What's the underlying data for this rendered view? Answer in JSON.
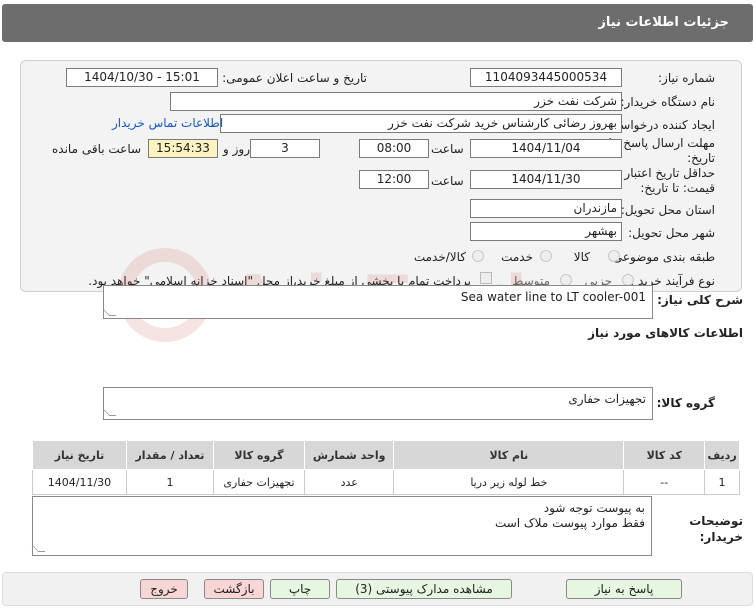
{
  "header": {
    "title": "جزئیات اطلاعات نیاز"
  },
  "form": {
    "need_number_label": "شماره نیاز:",
    "need_number": "1104093445000534",
    "announce_label": "تاریخ و ساعت اعلان عمومی:",
    "announce_value": "1404/10/30 - 15:01",
    "buyer_org_label": "نام دستگاه خریدار:",
    "buyer_org": "شرکت نفت خزر",
    "creator_label": "ایجاد کننده درخواست:",
    "creator": "بهروز رضائی کارشناس خرید شرکت نفت خزر",
    "contact_link": "اطلاعات تماس خریدار",
    "reply_deadline_label_1": "مهلت ارسال پاسخ: تا",
    "reply_deadline_label_2": "تاریخ:",
    "reply_date": "1404/11/04",
    "time_label": "ساعت",
    "reply_time": "08:00",
    "days_value": "3",
    "days_label": "روز و",
    "remaining_time": "15:54:33",
    "remaining_label": "ساعت باقی مانده",
    "price_validity_label_1": "حداقل تاریخ اعتبار",
    "price_validity_label_2": "قیمت: تا تاریخ:",
    "validity_date": "1404/11/30",
    "validity_time": "12:00",
    "province_label": "استان محل تحویل:",
    "province": "مازندران",
    "city_label": "شهر محل تحویل:",
    "city": "بهشهر",
    "category_label": "طبقه بندی موضوعی:",
    "category_options": [
      "کالا",
      "خدمت",
      "کالا/خدمت"
    ],
    "process_label": "نوع فرآیند خرید :",
    "process_options": [
      "جزیی",
      "متوسط"
    ],
    "payment_note": "پرداخت تمام یا بخشی از مبلغ خرید،از محل \"اسناد خزانه اسلامی\" خواهد بود."
  },
  "summary": {
    "label": "شرح کلی نیاز:",
    "value": "Sea water line to LT cooler-001"
  },
  "goods": {
    "section_title": "اطلاعات کالاهای مورد نیاز",
    "group_label": "گروه کالا:",
    "group_value": "تجهیزات حفاری"
  },
  "table": {
    "headers": [
      "ردیف",
      "کد کالا",
      "نام کالا",
      "واحد شمارش",
      "گروه کالا",
      "تعداد / مقدار",
      "تاریخ نیاز"
    ],
    "rows": [
      [
        "1",
        "--",
        "خط لوله زیر دریا",
        "عدد",
        "تجهیزات حفاری",
        "1",
        "1404/11/30"
      ]
    ]
  },
  "buyer_notes": {
    "label_1": "توضیحات",
    "label_2": "خریدار:",
    "text": "به پیوست توجه شود\nفقط موارد پیوست ملاک است"
  },
  "buttons": {
    "reply": "پاسخ به نیاز",
    "attachments": "مشاهده مدارک پیوستی (3)",
    "print": "چاپ",
    "back": "بازگشت",
    "exit": "خروج"
  },
  "watermark": {
    "text": "AriaTender.neT"
  }
}
